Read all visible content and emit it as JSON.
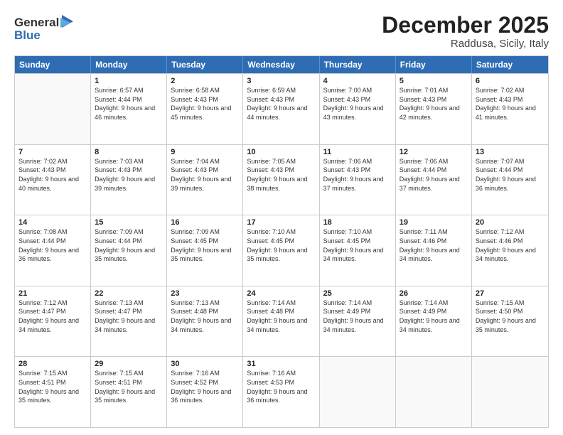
{
  "header": {
    "logo_general": "General",
    "logo_blue": "Blue",
    "title": "December 2025",
    "subtitle": "Raddusa, Sicily, Italy"
  },
  "days": [
    "Sunday",
    "Monday",
    "Tuesday",
    "Wednesday",
    "Thursday",
    "Friday",
    "Saturday"
  ],
  "weeks": [
    [
      {
        "day": "",
        "sunrise": "",
        "sunset": "",
        "daylight": ""
      },
      {
        "day": "1",
        "sunrise": "Sunrise: 6:57 AM",
        "sunset": "Sunset: 4:44 PM",
        "daylight": "Daylight: 9 hours and 46 minutes."
      },
      {
        "day": "2",
        "sunrise": "Sunrise: 6:58 AM",
        "sunset": "Sunset: 4:43 PM",
        "daylight": "Daylight: 9 hours and 45 minutes."
      },
      {
        "day": "3",
        "sunrise": "Sunrise: 6:59 AM",
        "sunset": "Sunset: 4:43 PM",
        "daylight": "Daylight: 9 hours and 44 minutes."
      },
      {
        "day": "4",
        "sunrise": "Sunrise: 7:00 AM",
        "sunset": "Sunset: 4:43 PM",
        "daylight": "Daylight: 9 hours and 43 minutes."
      },
      {
        "day": "5",
        "sunrise": "Sunrise: 7:01 AM",
        "sunset": "Sunset: 4:43 PM",
        "daylight": "Daylight: 9 hours and 42 minutes."
      },
      {
        "day": "6",
        "sunrise": "Sunrise: 7:02 AM",
        "sunset": "Sunset: 4:43 PM",
        "daylight": "Daylight: 9 hours and 41 minutes."
      }
    ],
    [
      {
        "day": "7",
        "sunrise": "Sunrise: 7:02 AM",
        "sunset": "Sunset: 4:43 PM",
        "daylight": "Daylight: 9 hours and 40 minutes."
      },
      {
        "day": "8",
        "sunrise": "Sunrise: 7:03 AM",
        "sunset": "Sunset: 4:43 PM",
        "daylight": "Daylight: 9 hours and 39 minutes."
      },
      {
        "day": "9",
        "sunrise": "Sunrise: 7:04 AM",
        "sunset": "Sunset: 4:43 PM",
        "daylight": "Daylight: 9 hours and 39 minutes."
      },
      {
        "day": "10",
        "sunrise": "Sunrise: 7:05 AM",
        "sunset": "Sunset: 4:43 PM",
        "daylight": "Daylight: 9 hours and 38 minutes."
      },
      {
        "day": "11",
        "sunrise": "Sunrise: 7:06 AM",
        "sunset": "Sunset: 4:43 PM",
        "daylight": "Daylight: 9 hours and 37 minutes."
      },
      {
        "day": "12",
        "sunrise": "Sunrise: 7:06 AM",
        "sunset": "Sunset: 4:44 PM",
        "daylight": "Daylight: 9 hours and 37 minutes."
      },
      {
        "day": "13",
        "sunrise": "Sunrise: 7:07 AM",
        "sunset": "Sunset: 4:44 PM",
        "daylight": "Daylight: 9 hours and 36 minutes."
      }
    ],
    [
      {
        "day": "14",
        "sunrise": "Sunrise: 7:08 AM",
        "sunset": "Sunset: 4:44 PM",
        "daylight": "Daylight: 9 hours and 36 minutes."
      },
      {
        "day": "15",
        "sunrise": "Sunrise: 7:09 AM",
        "sunset": "Sunset: 4:44 PM",
        "daylight": "Daylight: 9 hours and 35 minutes."
      },
      {
        "day": "16",
        "sunrise": "Sunrise: 7:09 AM",
        "sunset": "Sunset: 4:45 PM",
        "daylight": "Daylight: 9 hours and 35 minutes."
      },
      {
        "day": "17",
        "sunrise": "Sunrise: 7:10 AM",
        "sunset": "Sunset: 4:45 PM",
        "daylight": "Daylight: 9 hours and 35 minutes."
      },
      {
        "day": "18",
        "sunrise": "Sunrise: 7:10 AM",
        "sunset": "Sunset: 4:45 PM",
        "daylight": "Daylight: 9 hours and 34 minutes."
      },
      {
        "day": "19",
        "sunrise": "Sunrise: 7:11 AM",
        "sunset": "Sunset: 4:46 PM",
        "daylight": "Daylight: 9 hours and 34 minutes."
      },
      {
        "day": "20",
        "sunrise": "Sunrise: 7:12 AM",
        "sunset": "Sunset: 4:46 PM",
        "daylight": "Daylight: 9 hours and 34 minutes."
      }
    ],
    [
      {
        "day": "21",
        "sunrise": "Sunrise: 7:12 AM",
        "sunset": "Sunset: 4:47 PM",
        "daylight": "Daylight: 9 hours and 34 minutes."
      },
      {
        "day": "22",
        "sunrise": "Sunrise: 7:13 AM",
        "sunset": "Sunset: 4:47 PM",
        "daylight": "Daylight: 9 hours and 34 minutes."
      },
      {
        "day": "23",
        "sunrise": "Sunrise: 7:13 AM",
        "sunset": "Sunset: 4:48 PM",
        "daylight": "Daylight: 9 hours and 34 minutes."
      },
      {
        "day": "24",
        "sunrise": "Sunrise: 7:14 AM",
        "sunset": "Sunset: 4:48 PM",
        "daylight": "Daylight: 9 hours and 34 minutes."
      },
      {
        "day": "25",
        "sunrise": "Sunrise: 7:14 AM",
        "sunset": "Sunset: 4:49 PM",
        "daylight": "Daylight: 9 hours and 34 minutes."
      },
      {
        "day": "26",
        "sunrise": "Sunrise: 7:14 AM",
        "sunset": "Sunset: 4:49 PM",
        "daylight": "Daylight: 9 hours and 34 minutes."
      },
      {
        "day": "27",
        "sunrise": "Sunrise: 7:15 AM",
        "sunset": "Sunset: 4:50 PM",
        "daylight": "Daylight: 9 hours and 35 minutes."
      }
    ],
    [
      {
        "day": "28",
        "sunrise": "Sunrise: 7:15 AM",
        "sunset": "Sunset: 4:51 PM",
        "daylight": "Daylight: 9 hours and 35 minutes."
      },
      {
        "day": "29",
        "sunrise": "Sunrise: 7:15 AM",
        "sunset": "Sunset: 4:51 PM",
        "daylight": "Daylight: 9 hours and 35 minutes."
      },
      {
        "day": "30",
        "sunrise": "Sunrise: 7:16 AM",
        "sunset": "Sunset: 4:52 PM",
        "daylight": "Daylight: 9 hours and 36 minutes."
      },
      {
        "day": "31",
        "sunrise": "Sunrise: 7:16 AM",
        "sunset": "Sunset: 4:53 PM",
        "daylight": "Daylight: 9 hours and 36 minutes."
      },
      {
        "day": "",
        "sunrise": "",
        "sunset": "",
        "daylight": ""
      },
      {
        "day": "",
        "sunrise": "",
        "sunset": "",
        "daylight": ""
      },
      {
        "day": "",
        "sunrise": "",
        "sunset": "",
        "daylight": ""
      }
    ]
  ]
}
